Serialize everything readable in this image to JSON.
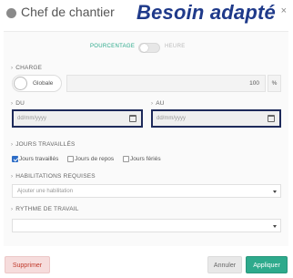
{
  "header": {
    "title": "Chef de chantier",
    "brand": "Besoin adapté",
    "close": "×"
  },
  "toggle": {
    "left_label": "POURCENTAGE",
    "right_label": "HEURE",
    "state": "pourcentage"
  },
  "charge": {
    "section": "CHARGE",
    "globale_label": "Globale",
    "value": "100",
    "unit": "%"
  },
  "dates": {
    "du_label": "DU",
    "au_label": "AU",
    "placeholder": "dd/mm/yyyy"
  },
  "jours": {
    "section": "JOURS TRAVAILLÉS",
    "options": [
      {
        "label": "Jours travaillés",
        "checked": true
      },
      {
        "label": "Jours de repos",
        "checked": false
      },
      {
        "label": "Jours fériés",
        "checked": false
      }
    ]
  },
  "habilitations": {
    "section": "HABILITATIONS REQUISES",
    "placeholder": "Ajouter une habilitation"
  },
  "rythme": {
    "section": "RYTHME DE TRAVAIL",
    "value": ""
  },
  "footer": {
    "delete_label": "Supprimer",
    "cancel_label": "Annuler",
    "apply_label": "Appliquer"
  },
  "colors": {
    "brand": "#1f3a8a",
    "accent": "#2eaa8c",
    "danger": "#c0392b",
    "highlight_border": "#1e2a5a"
  }
}
